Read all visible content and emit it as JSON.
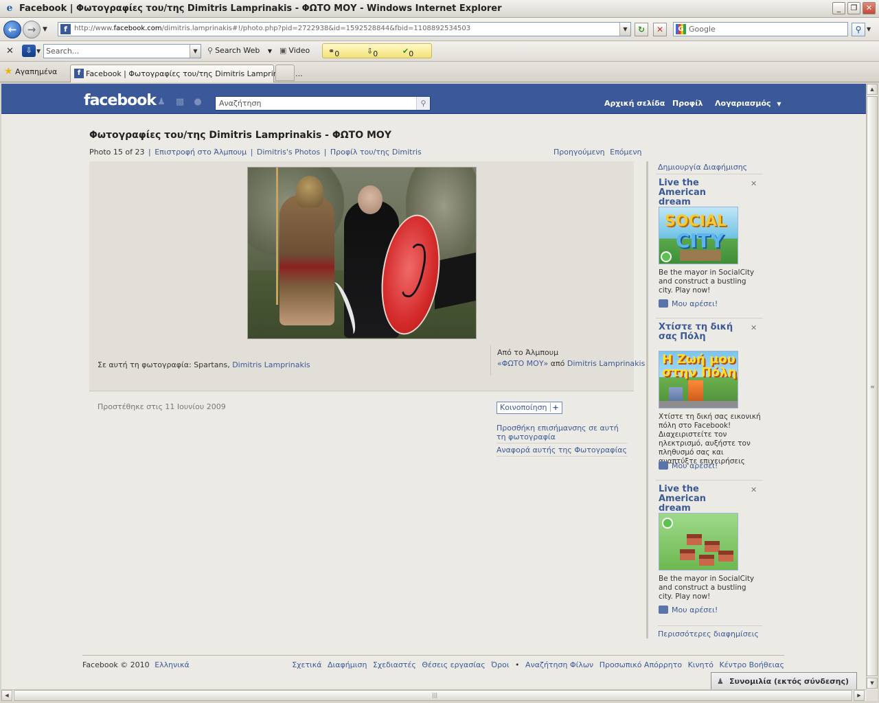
{
  "window": {
    "title": "Facebook | Φωτογραφίες του/της Dimitris Lamprinakis - ΦΩΤΟ ΜΟΥ - Windows Internet Explorer",
    "minimize": "_",
    "restore": "❐",
    "close": "✕"
  },
  "address": {
    "url_prefix": "http://www.",
    "url_domain": "facebook.com",
    "url_rest": "/dimitris.lamprinakis#!/photo.php?pid=2722938&id=1592528844&fbid=1108892534503"
  },
  "search_box": {
    "placeholder": "Google"
  },
  "toolbar": {
    "search_placeholder": "Search...",
    "search_web": "Search Web",
    "video": "Video",
    "counter_1": "0",
    "counter_2": "0",
    "counter_3": "0"
  },
  "tabs": {
    "favorites": "Αγαπημένα",
    "active_tab": "Facebook | Φωτογραφίες του/της Dimitris Lamprinakis ..."
  },
  "fb_header": {
    "logo": "facebook",
    "search_placeholder": "Αναζήτηση",
    "nav_home": "Αρχική σελίδα",
    "nav_profile": "Προφίλ",
    "nav_account": "Λογαριασμός"
  },
  "photo_page": {
    "title": "Φωτογραφίες του/της Dimitris Lamprinakis - ΦΩΤΟ ΜΟΥ",
    "photo_count": "Photo 15 of 23",
    "back_to_album": "Επιστροφή στο Άλμπουμ",
    "users_photos": "Dimitris's Photos",
    "profile_link": "Προφίλ του/της Dimitris",
    "prev": "Προηγούμενη",
    "next": "Επόμενη",
    "tags_label": "Σε αυτή τη φωτογραφία:",
    "tag_1": "Spartans",
    "tag_2": "Dimitris Lamprinakis",
    "from_album": "Από το Άλμπουμ",
    "album_name": "«ΦΩΤΟ ΜΟΥ»",
    "album_by": "από",
    "album_owner": "Dimitris Lamprinakis",
    "added_date": "Προστέθηκε στις 11 Ιουνίου 2009",
    "share": "Κοινοποίηση",
    "share_plus": "+",
    "add_tag": "Προσθήκη επισήμανσης σε αυτή τη φωτογραφία",
    "report": "Αναφορά αυτής της Φωτογραφίας"
  },
  "ads": {
    "create_ad": "Δημιουργία Διαφήμισης",
    "close": "✕",
    "like": "Μου αρέσει!",
    "items": [
      {
        "title": "Live the American dream",
        "image_text_1": "SOCIAL",
        "image_text_2": "CITY",
        "text": "Be the mayor in SocialCity and construct a bustling city. Play now!"
      },
      {
        "title": "Χτίστε τη δική σας Πόλη",
        "image_text_1": "Η Ζωή μου στην Πόλη",
        "text": "Χτίστε τη δική σας εικονική πόλη στο Facebook! Διαχειριστείτε τον ηλεκτρισμό, αυξήστε τον πληθυσμό σας και αναπτύξτε επιχειρήσεις"
      },
      {
        "title": "Live the American dream",
        "text": "Be the mayor in SocialCity and construct a bustling city. Play now!"
      }
    ],
    "more_ads": "Περισσότερες διαφημίσεις"
  },
  "footer": {
    "copyright": "Facebook © 2010",
    "language": "Ελληνικά",
    "links": [
      "Σχετικά",
      "Διαφήμιση",
      "Σχεδιαστές",
      "Θέσεις εργασίας",
      "Όροι",
      "•",
      "Αναζήτηση Φίλων",
      "Προσωπικό Απόρρητο",
      "Κινητό",
      "Κέντρο Βοήθειας"
    ]
  },
  "chat": {
    "label": "Συνομιλία (εκτός σύνδεσης)"
  }
}
